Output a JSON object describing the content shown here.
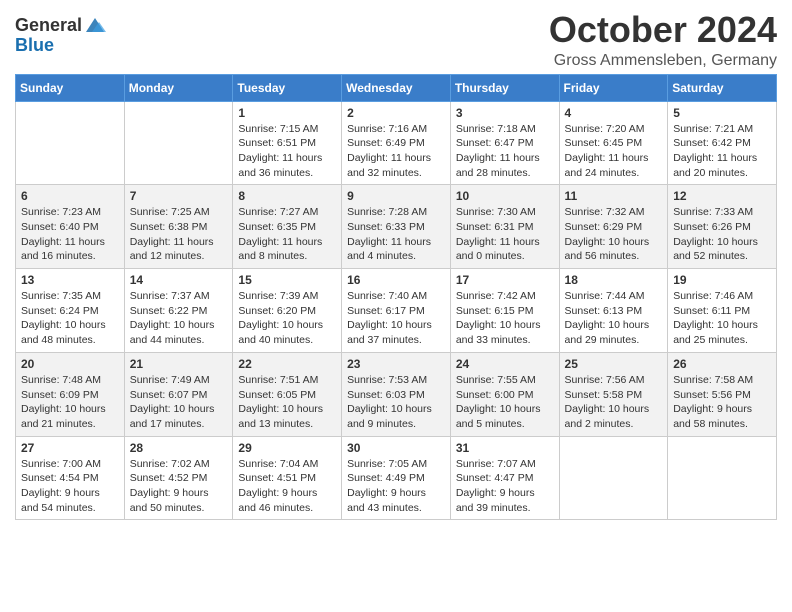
{
  "header": {
    "logo_general": "General",
    "logo_blue": "Blue",
    "month_title": "October 2024",
    "location": "Gross Ammensleben, Germany"
  },
  "days_of_week": [
    "Sunday",
    "Monday",
    "Tuesday",
    "Wednesday",
    "Thursday",
    "Friday",
    "Saturday"
  ],
  "weeks": [
    [
      {
        "day": "",
        "content": ""
      },
      {
        "day": "",
        "content": ""
      },
      {
        "day": "1",
        "content": "Sunrise: 7:15 AM\nSunset: 6:51 PM\nDaylight: 11 hours\nand 36 minutes."
      },
      {
        "day": "2",
        "content": "Sunrise: 7:16 AM\nSunset: 6:49 PM\nDaylight: 11 hours\nand 32 minutes."
      },
      {
        "day": "3",
        "content": "Sunrise: 7:18 AM\nSunset: 6:47 PM\nDaylight: 11 hours\nand 28 minutes."
      },
      {
        "day": "4",
        "content": "Sunrise: 7:20 AM\nSunset: 6:45 PM\nDaylight: 11 hours\nand 24 minutes."
      },
      {
        "day": "5",
        "content": "Sunrise: 7:21 AM\nSunset: 6:42 PM\nDaylight: 11 hours\nand 20 minutes."
      }
    ],
    [
      {
        "day": "6",
        "content": "Sunrise: 7:23 AM\nSunset: 6:40 PM\nDaylight: 11 hours\nand 16 minutes."
      },
      {
        "day": "7",
        "content": "Sunrise: 7:25 AM\nSunset: 6:38 PM\nDaylight: 11 hours\nand 12 minutes."
      },
      {
        "day": "8",
        "content": "Sunrise: 7:27 AM\nSunset: 6:35 PM\nDaylight: 11 hours\nand 8 minutes."
      },
      {
        "day": "9",
        "content": "Sunrise: 7:28 AM\nSunset: 6:33 PM\nDaylight: 11 hours\nand 4 minutes."
      },
      {
        "day": "10",
        "content": "Sunrise: 7:30 AM\nSunset: 6:31 PM\nDaylight: 11 hours\nand 0 minutes."
      },
      {
        "day": "11",
        "content": "Sunrise: 7:32 AM\nSunset: 6:29 PM\nDaylight: 10 hours\nand 56 minutes."
      },
      {
        "day": "12",
        "content": "Sunrise: 7:33 AM\nSunset: 6:26 PM\nDaylight: 10 hours\nand 52 minutes."
      }
    ],
    [
      {
        "day": "13",
        "content": "Sunrise: 7:35 AM\nSunset: 6:24 PM\nDaylight: 10 hours\nand 48 minutes."
      },
      {
        "day": "14",
        "content": "Sunrise: 7:37 AM\nSunset: 6:22 PM\nDaylight: 10 hours\nand 44 minutes."
      },
      {
        "day": "15",
        "content": "Sunrise: 7:39 AM\nSunset: 6:20 PM\nDaylight: 10 hours\nand 40 minutes."
      },
      {
        "day": "16",
        "content": "Sunrise: 7:40 AM\nSunset: 6:17 PM\nDaylight: 10 hours\nand 37 minutes."
      },
      {
        "day": "17",
        "content": "Sunrise: 7:42 AM\nSunset: 6:15 PM\nDaylight: 10 hours\nand 33 minutes."
      },
      {
        "day": "18",
        "content": "Sunrise: 7:44 AM\nSunset: 6:13 PM\nDaylight: 10 hours\nand 29 minutes."
      },
      {
        "day": "19",
        "content": "Sunrise: 7:46 AM\nSunset: 6:11 PM\nDaylight: 10 hours\nand 25 minutes."
      }
    ],
    [
      {
        "day": "20",
        "content": "Sunrise: 7:48 AM\nSunset: 6:09 PM\nDaylight: 10 hours\nand 21 minutes."
      },
      {
        "day": "21",
        "content": "Sunrise: 7:49 AM\nSunset: 6:07 PM\nDaylight: 10 hours\nand 17 minutes."
      },
      {
        "day": "22",
        "content": "Sunrise: 7:51 AM\nSunset: 6:05 PM\nDaylight: 10 hours\nand 13 minutes."
      },
      {
        "day": "23",
        "content": "Sunrise: 7:53 AM\nSunset: 6:03 PM\nDaylight: 10 hours\nand 9 minutes."
      },
      {
        "day": "24",
        "content": "Sunrise: 7:55 AM\nSunset: 6:00 PM\nDaylight: 10 hours\nand 5 minutes."
      },
      {
        "day": "25",
        "content": "Sunrise: 7:56 AM\nSunset: 5:58 PM\nDaylight: 10 hours\nand 2 minutes."
      },
      {
        "day": "26",
        "content": "Sunrise: 7:58 AM\nSunset: 5:56 PM\nDaylight: 9 hours\nand 58 minutes."
      }
    ],
    [
      {
        "day": "27",
        "content": "Sunrise: 7:00 AM\nSunset: 4:54 PM\nDaylight: 9 hours\nand 54 minutes."
      },
      {
        "day": "28",
        "content": "Sunrise: 7:02 AM\nSunset: 4:52 PM\nDaylight: 9 hours\nand 50 minutes."
      },
      {
        "day": "29",
        "content": "Sunrise: 7:04 AM\nSunset: 4:51 PM\nDaylight: 9 hours\nand 46 minutes."
      },
      {
        "day": "30",
        "content": "Sunrise: 7:05 AM\nSunset: 4:49 PM\nDaylight: 9 hours\nand 43 minutes."
      },
      {
        "day": "31",
        "content": "Sunrise: 7:07 AM\nSunset: 4:47 PM\nDaylight: 9 hours\nand 39 minutes."
      },
      {
        "day": "",
        "content": ""
      },
      {
        "day": "",
        "content": ""
      }
    ]
  ]
}
